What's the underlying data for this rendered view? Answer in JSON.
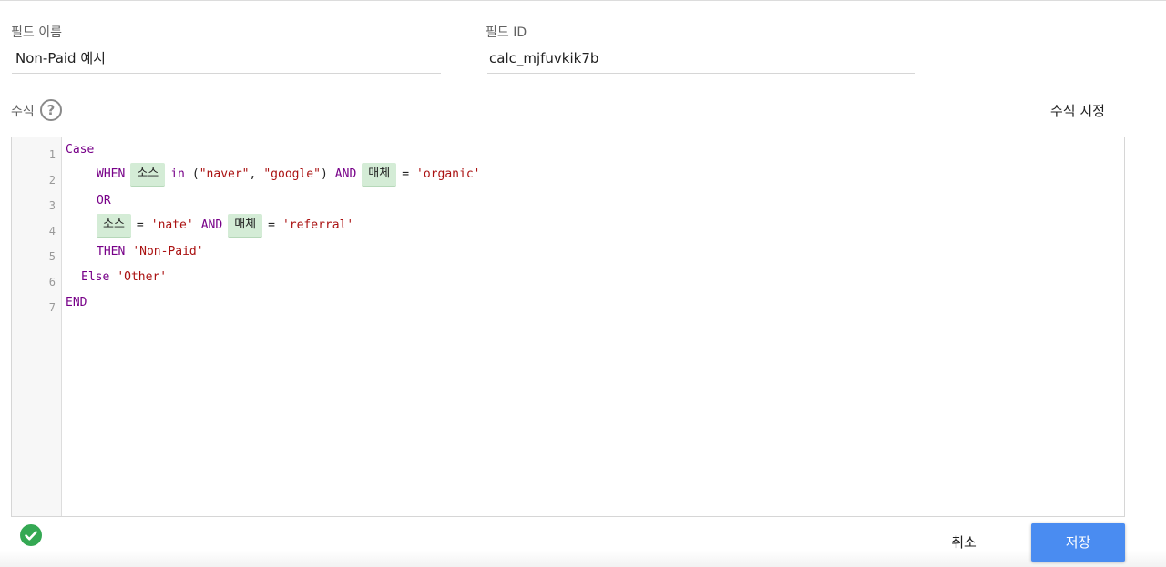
{
  "field_name": {
    "label": "필드 이름",
    "value": "Non-Paid 예시"
  },
  "field_id": {
    "label": "필드 ID",
    "value": "calc_mjfuvkik7b"
  },
  "formula": {
    "label": "수식",
    "help_glyph": "?",
    "assign_label": "수식 지정"
  },
  "editor": {
    "line_numbers": [
      "1",
      "2",
      "3",
      "4",
      "5",
      "6",
      "7"
    ],
    "line1": {
      "kw": "Case"
    },
    "line2": {
      "kw_when": "WHEN",
      "chip_source": "소스",
      "kw_in": "in",
      "paren_open": "(",
      "str_naver": "\"naver\"",
      "comma": ",",
      "str_google": "\"google\"",
      "paren_close": ")",
      "kw_and": "AND",
      "chip_medium": "매체",
      "eq": "=",
      "str_organic": "'organic'"
    },
    "line3": {
      "kw": "OR"
    },
    "line4": {
      "chip_source": "소스",
      "eq": "=",
      "str_nate": "'nate'",
      "kw_and": "AND",
      "chip_medium": "매체",
      "eq2": "=",
      "str_referral": "'referral'"
    },
    "line5": {
      "kw": "THEN",
      "str": "'Non-Paid'"
    },
    "line6": {
      "kw": "Else",
      "str": "'Other'"
    },
    "line7": {
      "kw": "END"
    }
  },
  "status": {
    "icon": "check-circle-icon",
    "color": "#34a853"
  },
  "actions": {
    "cancel_label": "취소",
    "save_label": "저장"
  },
  "colors": {
    "accent": "#4a8cf1",
    "keyword": "#770088",
    "string": "#aa1111",
    "chip": "#d4ecd6"
  }
}
